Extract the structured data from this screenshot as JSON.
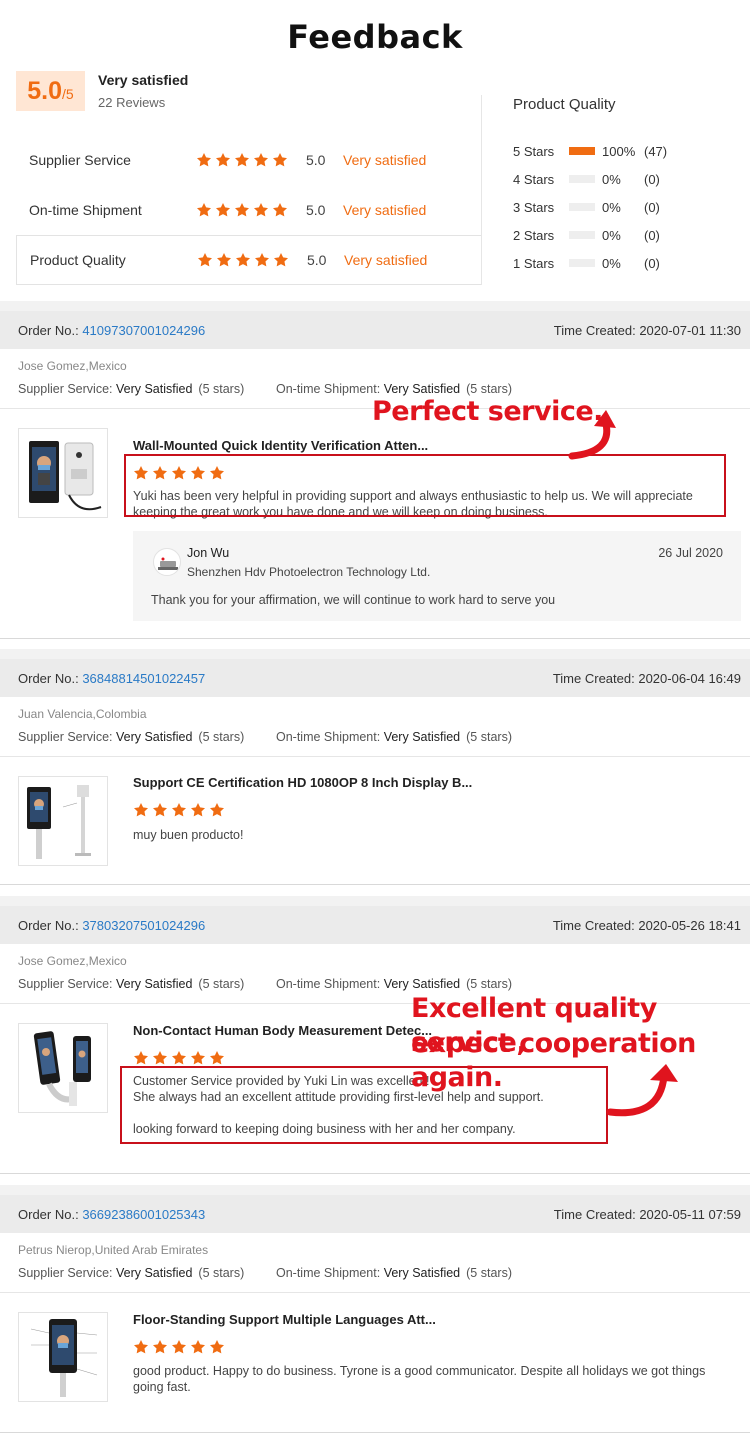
{
  "page": {
    "title": "Feedback"
  },
  "colors": {
    "accent": "#f06c12",
    "link": "#2a7ac6",
    "annotation": "#e0141e"
  },
  "summary": {
    "score": "5.0",
    "score_scale": "/5",
    "label": "Very satisfied",
    "reviews": "22 Reviews",
    "ratings": [
      {
        "name": "Supplier Service",
        "value": "5.0",
        "text": "Very satisfied",
        "stars": 5
      },
      {
        "name": "On-time Shipment",
        "value": "5.0",
        "text": "Very satisfied",
        "stars": 5
      },
      {
        "name": "Product Quality",
        "value": "5.0",
        "text": "Very satisfied",
        "stars": 5
      }
    ]
  },
  "product_quality": {
    "title": "Product Quality",
    "rows": [
      {
        "label": "5  Stars",
        "percent": "100%",
        "count": "(47)",
        "fraction": 1.0
      },
      {
        "label": "4  Stars",
        "percent": "0%",
        "count": "(0)",
        "fraction": 0
      },
      {
        "label": "3  Stars",
        "percent": "0%",
        "count": "(0)",
        "fraction": 0
      },
      {
        "label": "2  Stars",
        "percent": "0%",
        "count": "(0)",
        "fraction": 0
      },
      {
        "label": "1  Stars",
        "percent": "0%",
        "count": "(0)",
        "fraction": 0
      }
    ]
  },
  "labels": {
    "order_no": "Order No.:",
    "time_created": "Time Created:",
    "supplier_service": "Supplier Service:",
    "ontime_shipment": "On-time Shipment:"
  },
  "orders": [
    {
      "order_no": "41097307001024296",
      "time": "2020-07-01 11:30",
      "buyer": "Jose Gomez,Mexico",
      "supplier_rating": "Very Satisfied",
      "supplier_stars": "(5 stars)",
      "shipment_rating": "Very Satisfied",
      "shipment_stars": "(5 stars)",
      "product": "Wall-Mounted Quick Identity Verification Atten...",
      "stars": 5,
      "text": "Yuki has been very helpful in providing support and always enthusiastic to help us. We will appreciate keeping the great work you have done and we will keep on doing business."
    },
    {
      "order_no": "36848814501022457",
      "time": "2020-06-04 16:49",
      "buyer": "Juan Valencia,Colombia",
      "supplier_rating": "Very Satisfied",
      "supplier_stars": "(5 stars)",
      "shipment_rating": "Very Satisfied",
      "shipment_stars": "(5 stars)",
      "product": "Support CE Certification HD 1080OP 8 Inch Display B...",
      "stars": 5,
      "text": "muy buen producto!"
    },
    {
      "order_no": "37803207501024296",
      "time": "2020-05-26 18:41",
      "buyer": "Jose Gomez,Mexico",
      "supplier_rating": "Very Satisfied",
      "supplier_stars": "(5 stars)",
      "shipment_rating": "Very Satisfied",
      "shipment_stars": "(5 stars)",
      "product": "Non-Contact Human Body Measurement Detec...",
      "stars": 5,
      "text_lines": [
        "Customer Service provided by Yuki Lin was excellent!",
        "She always had an excellent attitude providing first-level help and support.",
        "",
        "looking forward to keeping doing business with her and her company."
      ]
    },
    {
      "order_no": "36692386001025343",
      "time": "2020-05-11 07:59",
      "buyer": "Petrus Nierop,United Arab Emirates",
      "supplier_rating": "Very Satisfied",
      "supplier_stars": "(5 stars)",
      "shipment_rating": "Very Satisfied",
      "shipment_stars": "(5 stars)",
      "product": "Floor-Standing Support Multiple Languages Att...",
      "stars": 5,
      "text": "good product. Happy to do business. Tyrone is a good communicator. Despite all holidays we got things going fast."
    }
  ],
  "reply": {
    "name": "Jon Wu",
    "company": "Shenzhen Hdv Photoelectron Technology Ltd.",
    "date": "26 Jul 2020",
    "message": "Thank you for your affirmation, we will continue to work hard to serve you"
  },
  "annotations": {
    "first": "Perfect service.",
    "second_line1": "Excellent quality service,",
    "second_line2": "expect cooperation again."
  }
}
